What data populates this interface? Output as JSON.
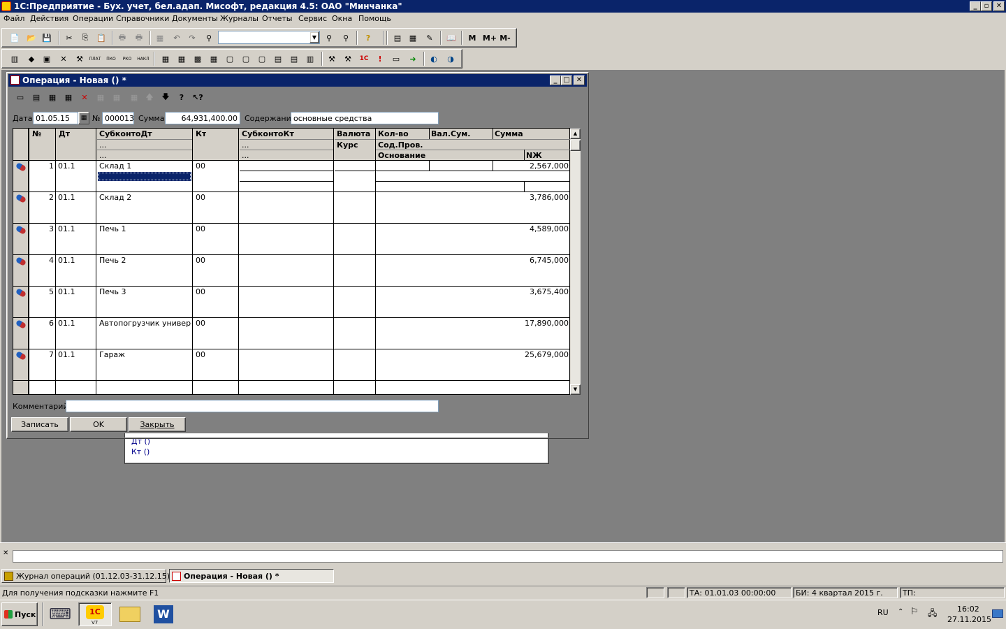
{
  "app": {
    "title": "1С:Предприятие - Бух. учет, бел.адап. Мисофт, редакция 4.5: ОАО \"Минчанка\""
  },
  "menu": [
    "Файл",
    "Действия",
    "Операции",
    "Справочники",
    "Документы",
    "Журналы",
    "Отчеты",
    "Сервис",
    "Окна",
    "Помощь"
  ],
  "toolbar": {
    "m_label": "М",
    "mplus_label": "М+",
    "mminus_label": "М-"
  },
  "doc": {
    "title": "Операция - Новая () *",
    "date_label": "Дата",
    "date_value": "01.05.15",
    "num_label": "№",
    "num_value": "000013",
    "sum_label": "Сумма",
    "sum_value": "64,931,400.00",
    "content_label": "Содержание",
    "content_value": "основные средства",
    "comment_label": "Комментарий:",
    "comment_value": "",
    "btn_save": "Записать",
    "btn_ok": "OK",
    "btn_close": "Закрыть"
  },
  "table": {
    "headers": {
      "num": "№",
      "dt": "Дт",
      "subkonto_dt": "СубконтоДт",
      "dots": "...",
      "kt": "Кт",
      "subkonto_kt": "СубконтоКт",
      "currency": "Валюта",
      "rate": "Курс",
      "qty": "Кол-во",
      "cur_sum": "Вал.Сум.",
      "sum": "Сумма",
      "content": "Сод.Пров.",
      "basis": "Основание",
      "nzh": "NЖ"
    },
    "rows": [
      {
        "n": "1",
        "dt": "01.1",
        "sub": "Склад 1",
        "kt": "00",
        "sum": "2,567,000"
      },
      {
        "n": "2",
        "dt": "01.1",
        "sub": "Склад 2",
        "kt": "00",
        "sum": "3,786,000"
      },
      {
        "n": "3",
        "dt": "01.1",
        "sub": "Печь 1",
        "kt": "00",
        "sum": "4,589,000"
      },
      {
        "n": "4",
        "dt": "01.1",
        "sub": "Печь 2",
        "kt": "00",
        "sum": "6,745,000"
      },
      {
        "n": "5",
        "dt": "01.1",
        "sub": "Печь 3",
        "kt": "00",
        "sum": "3,675,400"
      },
      {
        "n": "6",
        "dt": "01.1",
        "sub": "Автопогрузчик универс. Ч",
        "kt": "00",
        "sum": "17,890,000"
      },
      {
        "n": "7",
        "dt": "01.1",
        "sub": "Гараж",
        "kt": "00",
        "sum": "25,679,000"
      }
    ]
  },
  "background_window": {
    "line1": "Дт ()",
    "line2": "Кт ()"
  },
  "taskbar_windows": [
    {
      "label": "Журнал операций  (01.12.03-31.12.15)"
    },
    {
      "label": "Операция - Новая () *"
    }
  ],
  "status": {
    "hint": "Для получения подсказки нажмите F1",
    "ta": "ТА: 01.01.03  00:00:00",
    "bi": "БИ: 4 квартал 2015 г.",
    "tp": "ТП:"
  },
  "os_taskbar": {
    "start": "Пуск",
    "lang": "RU",
    "time": "16:02",
    "date": "27.11.2015",
    "v7_label": "V7"
  }
}
